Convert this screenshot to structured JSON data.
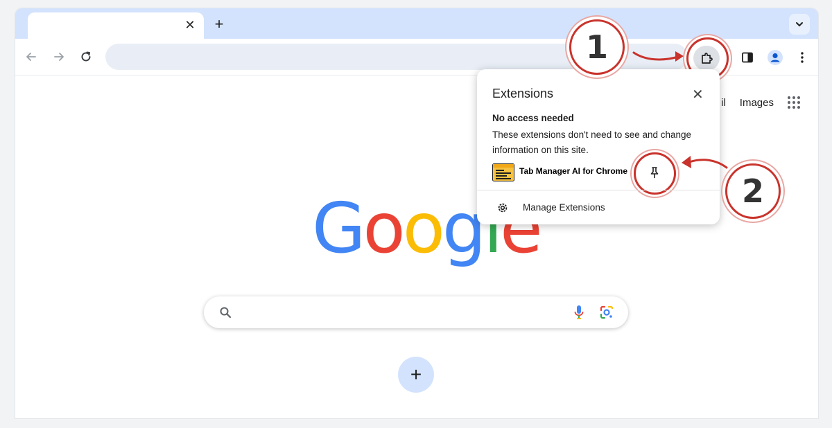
{
  "browser": {
    "tab": {
      "close_glyph": "✕"
    },
    "new_tab_glyph": "+",
    "tab_list_icon": "chevron-down-icon"
  },
  "toolbar": {
    "back_icon": "arrow-left-icon",
    "forward_icon": "arrow-right-icon",
    "reload_icon": "reload-icon",
    "extensions_icon": "puzzle-piece-icon",
    "side_panel_icon": "side-panel-icon",
    "profile_icon": "avatar-icon",
    "menu_icon": "kebab-menu-icon"
  },
  "ntp": {
    "top_links": [
      "il",
      "Images"
    ],
    "logo_letters": [
      {
        "char": "G",
        "color": "#4285F4"
      },
      {
        "char": "o",
        "color": "#EA4335"
      },
      {
        "char": "o",
        "color": "#FBBC05"
      },
      {
        "char": "g",
        "color": "#4285F4"
      },
      {
        "char": "l",
        "color": "#34A853"
      },
      {
        "char": "e",
        "color": "#EA4335"
      }
    ],
    "add_shortcut_glyph": "+"
  },
  "extensions_popup": {
    "title": "Extensions",
    "close_glyph": "✕",
    "section_heading": "No access needed",
    "section_description": "These extensions don't need to see and change information on this site.",
    "extension_name": "Tab Manager AI for Chrome",
    "manage_label": "Manage Extensions"
  },
  "annotations": {
    "step1_label": "1",
    "step2_label": "2",
    "accent_color": "#c9332c"
  }
}
